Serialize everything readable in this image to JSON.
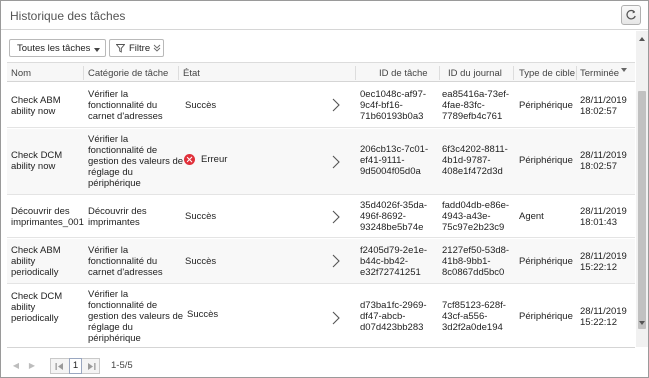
{
  "panel": {
    "title": "Historique des tâches"
  },
  "toolbar": {
    "dropdown_value": "Toutes les tâches",
    "filter_label": "Filtre"
  },
  "columns": {
    "name": "Nom",
    "category": "Catégorie de tâche",
    "state": "État",
    "task_id": "ID de tâche",
    "journal_id": "ID du journal",
    "target_type": "Type de cible",
    "finished": "Terminée"
  },
  "rows": [
    {
      "name": [
        "Check ABM",
        "ability now"
      ],
      "category": [
        "Vérifier la",
        "fonctionnalité du",
        "carnet d'adresses"
      ],
      "state": "Succès",
      "error": false,
      "task_id": [
        "0ec1048c-af97-",
        "9c4f-bf16-",
        "71b60193b0a3"
      ],
      "journal_id": [
        "ea85416a-73ef-",
        "4fae-83fc-",
        "7789efb4c761"
      ],
      "target_type": "Périphérique",
      "finished": [
        "28/11/2019",
        "18:02:57"
      ]
    },
    {
      "name": [
        "Check DCM",
        "ability now"
      ],
      "category": [
        "Vérifier la",
        "fonctionnalité de",
        "gestion des valeurs de",
        "réglage du",
        "périphérique"
      ],
      "state": "Erreur",
      "error": true,
      "task_id": [
        "206cb13c-7c01-",
        "ef41-9111-",
        "9d5004f05d0a"
      ],
      "journal_id": [
        "6f3c4202-8811-",
        "4b1d-9787-",
        "408e1f472d3d"
      ],
      "target_type": "Périphérique",
      "finished": [
        "28/11/2019",
        "18:02:57"
      ]
    },
    {
      "name": [
        "Découvrir des",
        "imprimantes_001"
      ],
      "category": [
        "Découvrir des",
        "imprimantes"
      ],
      "state": "Succès",
      "error": false,
      "task_id": [
        "35d4026f-35da-",
        "496f-8692-",
        "93248be5b74e"
      ],
      "journal_id": [
        "fadd04db-e86e-",
        "4943-a43e-",
        "75c97e2b23c9"
      ],
      "target_type": "Agent",
      "finished": [
        "28/11/2019",
        "18:01:43"
      ]
    },
    {
      "name": [
        "Check ABM",
        "ability",
        "periodically"
      ],
      "category": [
        "Vérifier la",
        "fonctionnalité du",
        "carnet d'adresses"
      ],
      "state": "Succès",
      "error": false,
      "task_id": [
        "f2405d79-2e1e-",
        "b44c-bb42-",
        "e32f72741251"
      ],
      "journal_id": [
        "2127ef50-53d8-",
        "41b8-9bb1-",
        "8c0867dd5bc0"
      ],
      "target_type": "Périphérique",
      "finished": [
        "28/11/2019",
        "15:22:12"
      ]
    },
    {
      "name": [
        "Check DCM",
        "ability",
        "periodically"
      ],
      "category": [
        "Vérifier la",
        "fonctionnalité de",
        "gestion des valeurs de",
        "réglage du",
        "périphérique"
      ],
      "state": "Succès",
      "error": false,
      "task_id": [
        "d73ba1fc-2969-",
        "df47-abcb-",
        "d07d423bb283"
      ],
      "journal_id": [
        "7cf85123-628f-",
        "43cf-a556-",
        "3d2f2a0de194"
      ],
      "target_type": "Périphérique",
      "finished": [
        "28/11/2019",
        "15:22:12"
      ]
    }
  ],
  "pager": {
    "current_page": "1",
    "range": "1-5/5"
  },
  "icons": {
    "refresh": "refresh-icon",
    "filter": "filter-icon",
    "row_chevron": "chevron-right-icon",
    "error": "error-icon",
    "sort": "sort-desc-icon"
  },
  "colors": {
    "error": "#e0303a",
    "header_bg": "#f7f7f7",
    "alt_row": "#f8f8f8"
  }
}
